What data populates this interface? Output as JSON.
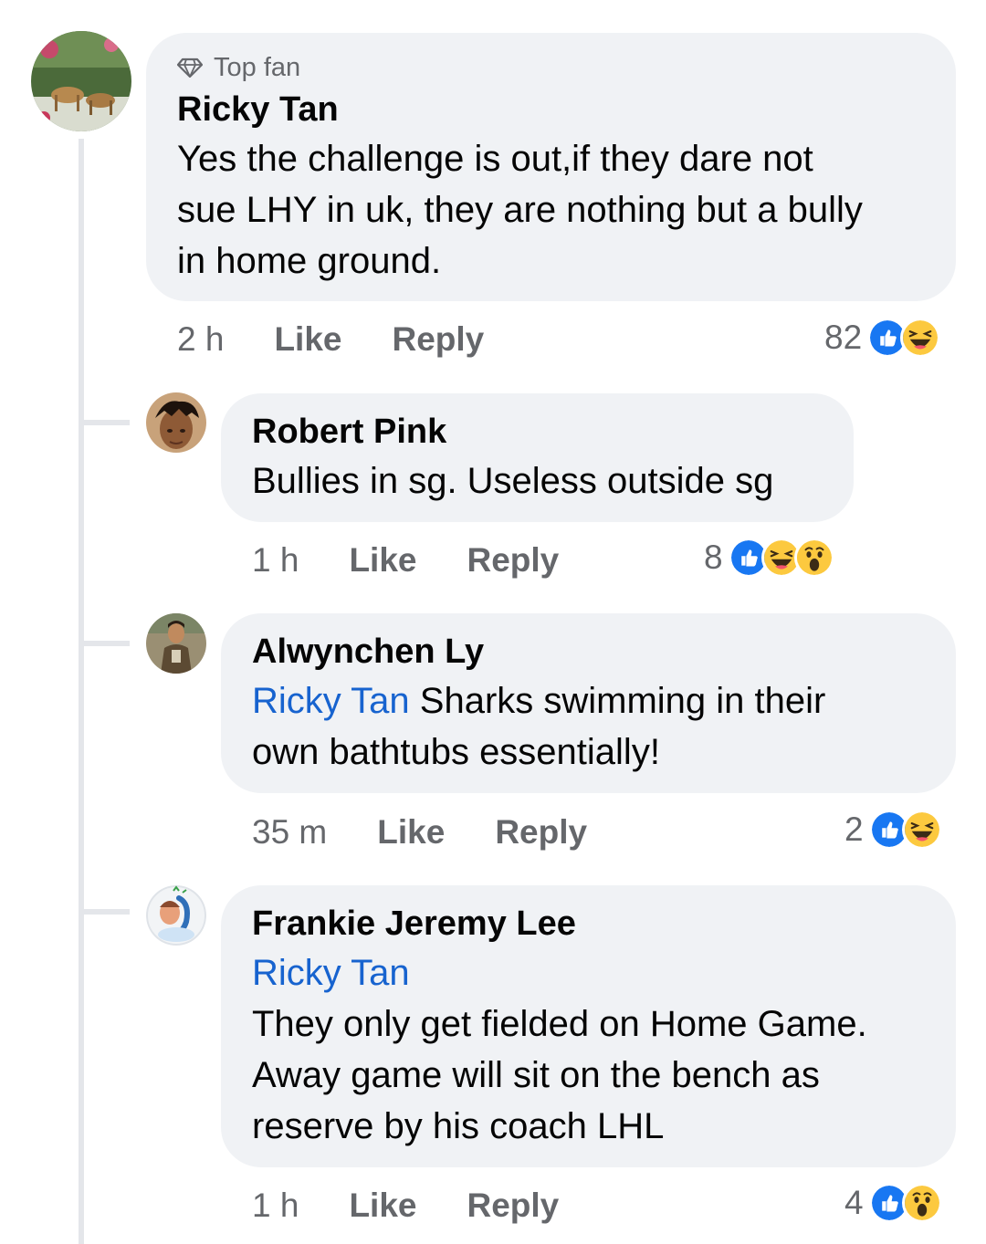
{
  "comments": [
    {
      "badge": "Top fan",
      "author": "Ricky Tan",
      "text": "Yes the challenge is out,if they dare not\nsue LHY in uk, they are nothing but a bully\nin home ground.",
      "time": "2 h",
      "like_label": "Like",
      "reply_label": "Reply",
      "reaction_count": "82",
      "reactions": [
        "like-icon",
        "haha-icon"
      ]
    }
  ],
  "replies": [
    {
      "author": "Robert Pink",
      "text": "Bullies in sg. Useless outside sg",
      "time": "1 h",
      "like_label": "Like",
      "reply_label": "Reply",
      "reaction_count": "8",
      "reactions": [
        "like-icon",
        "haha-icon",
        "wow-icon"
      ]
    },
    {
      "author": "Alwynchen Ly",
      "mention": "Ricky Tan",
      "text": " Sharks swimming in their\nown bathtubs essentially!",
      "time": "35 m",
      "like_label": "Like",
      "reply_label": "Reply",
      "reaction_count": "2",
      "reactions": [
        "like-icon",
        "haha-icon"
      ]
    },
    {
      "author": "Frankie Jeremy Lee",
      "mention": "Ricky Tan",
      "text": "They only get fielded on Home Game.\nAway game will  sit on the bench as\nreserve by his coach LHL",
      "time": "1 h",
      "like_label": "Like",
      "reply_label": "Reply",
      "reaction_count": "4",
      "reactions": [
        "like-icon",
        "wow-icon"
      ]
    }
  ],
  "colors": {
    "bubble": "#f0f2f5",
    "mention": "#1763cf",
    "muted": "#65676b",
    "like_blue": "#1877f2",
    "emoji_yellow": "#fcc93f"
  }
}
